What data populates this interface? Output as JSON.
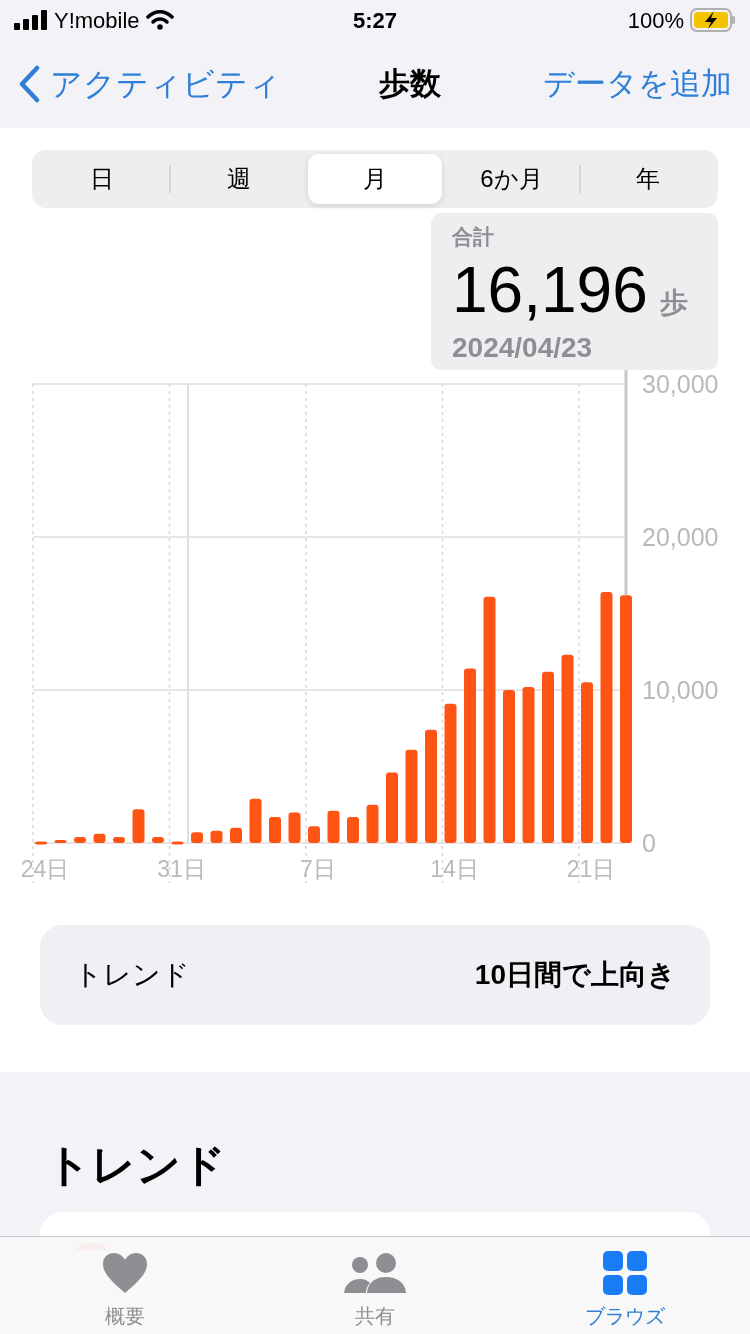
{
  "status_bar": {
    "carrier": "Y!mobile",
    "time": "5:27",
    "battery": "100%"
  },
  "nav": {
    "back": "アクティビティ",
    "title": "歩数",
    "action": "データを追加"
  },
  "segments": [
    {
      "label": "日",
      "selected": false
    },
    {
      "label": "週",
      "selected": false
    },
    {
      "label": "月",
      "selected": true
    },
    {
      "label": "6か月",
      "selected": false
    },
    {
      "label": "年",
      "selected": false
    }
  ],
  "callout": {
    "label": "合計",
    "value": "16,196",
    "unit": "歩",
    "date": "2024/04/23"
  },
  "chart_data": {
    "type": "bar",
    "values": [
      100,
      200,
      400,
      600,
      400,
      2200,
      400,
      100,
      700,
      800,
      1000,
      2900,
      1700,
      2000,
      1100,
      2100,
      1700,
      2500,
      4600,
      6100,
      7400,
      9100,
      11400,
      16100,
      10000,
      10200,
      11200,
      12300,
      10500,
      16400,
      16200
    ],
    "categories": [
      "24日",
      null,
      null,
      null,
      null,
      null,
      null,
      "31日",
      null,
      null,
      null,
      null,
      null,
      null,
      "7日",
      null,
      null,
      null,
      null,
      null,
      null,
      "14日",
      null,
      null,
      null,
      null,
      null,
      null,
      "21日",
      null,
      null
    ],
    "yticks": [
      {
        "value": 0,
        "label": "0"
      },
      {
        "value": 10000,
        "label": "10,000"
      },
      {
        "value": 20000,
        "label": "20,000"
      },
      {
        "value": 30000,
        "label": "30,000"
      }
    ],
    "ylim": [
      0,
      30000
    ]
  },
  "trend_row": {
    "label": "トレンド",
    "value": "10日間で上向き"
  },
  "section_title": "トレンド",
  "tab_bar": [
    {
      "label": "概要",
      "kind": "heart",
      "selected": false
    },
    {
      "label": "共有",
      "kind": "people",
      "selected": false
    },
    {
      "label": "ブラウズ",
      "kind": "grid",
      "selected": true
    }
  ]
}
